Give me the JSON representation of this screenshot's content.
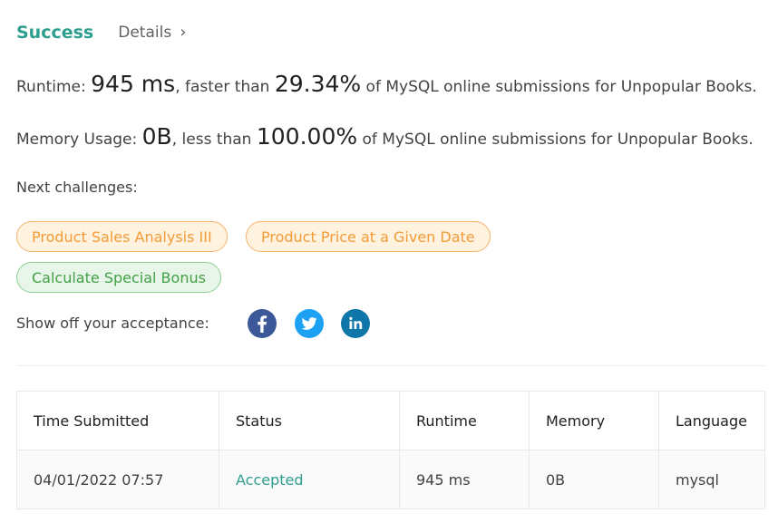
{
  "result": {
    "status": "Success",
    "details_label": "Details",
    "details_chevron": "›"
  },
  "runtime": {
    "label": "Runtime:",
    "value": "945 ms",
    "compare_text": ", faster than",
    "percent": "29.34%",
    "suffix": "of MySQL online submissions for Unpopular Books."
  },
  "memory": {
    "label": "Memory Usage:",
    "value": "0B",
    "compare_text": ", less than",
    "percent": "100.00%",
    "suffix": "of MySQL online submissions for Unpopular Books."
  },
  "next_challenges": {
    "label": "Next challenges:",
    "items": [
      {
        "title": "Product Sales Analysis III",
        "difficulty": "medium"
      },
      {
        "title": "Product Price at a Given Date",
        "difficulty": "medium"
      },
      {
        "title": "Calculate Special Bonus",
        "difficulty": "easy"
      }
    ]
  },
  "share": {
    "label": "Show off your acceptance:",
    "icons": [
      "facebook-icon",
      "twitter-icon",
      "linkedin-icon"
    ]
  },
  "submissions": {
    "columns": [
      "Time Submitted",
      "Status",
      "Runtime",
      "Memory",
      "Language"
    ],
    "rows": [
      {
        "time": "04/01/2022 07:57",
        "status": "Accepted",
        "runtime": "945 ms",
        "memory": "0B",
        "language": "mysql"
      }
    ]
  },
  "colors": {
    "success": "#2e9e8e",
    "medium_text": "#f29b38",
    "medium_bg": "#fff3e0",
    "easy_text": "#43a047",
    "easy_bg": "#e8f5e9",
    "facebook": "#3b5998",
    "twitter": "#1da1f2",
    "linkedin": "#0e76a8"
  }
}
